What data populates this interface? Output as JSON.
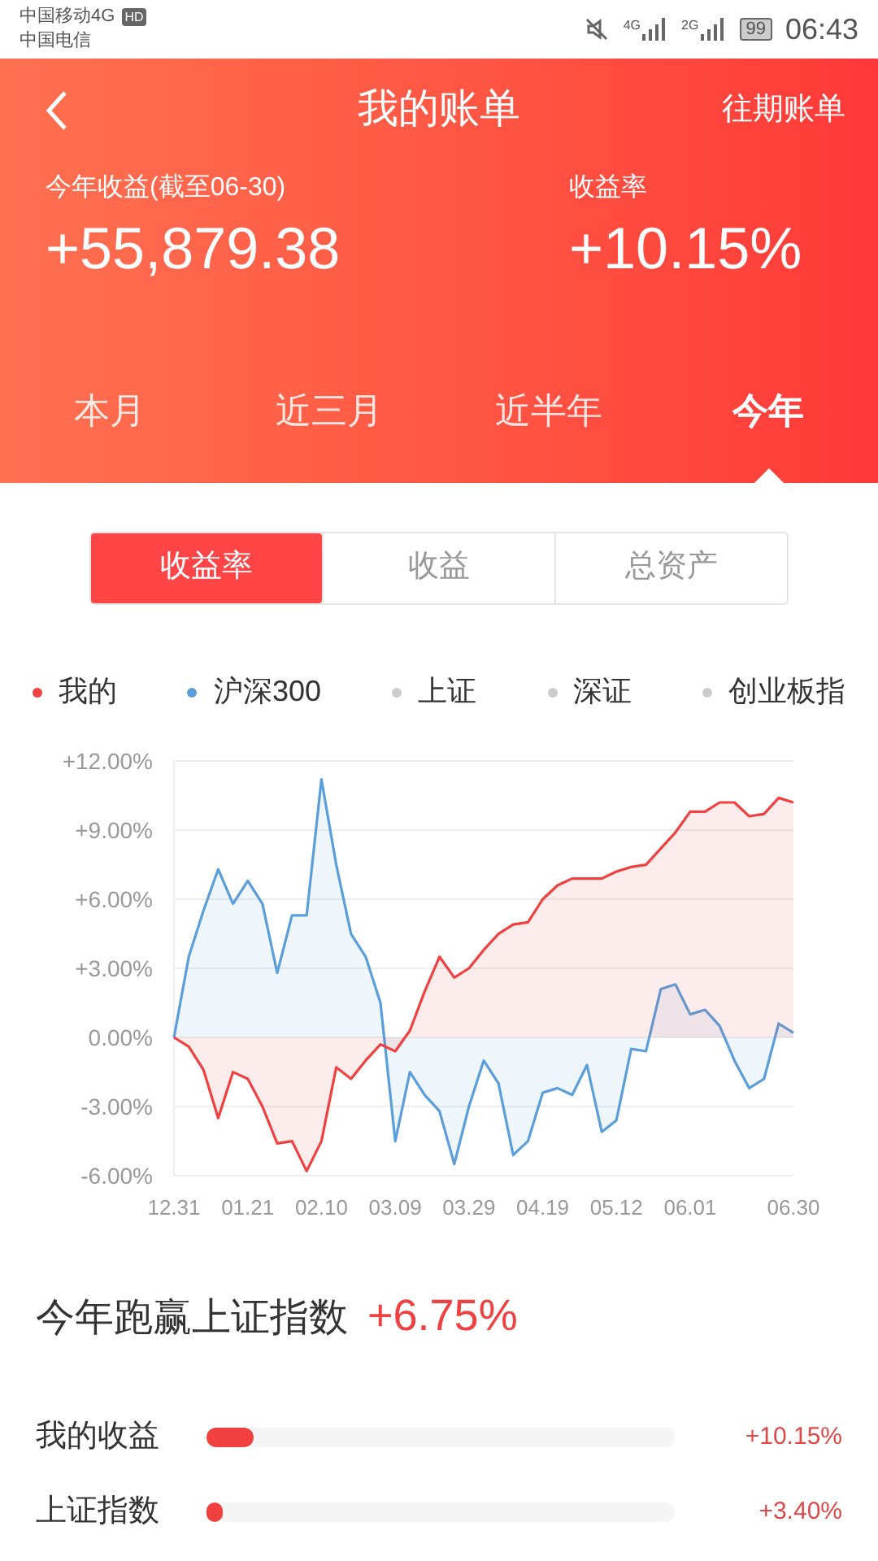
{
  "status_bar": {
    "carrier_1": "中国移动4G",
    "carrier_1_badge": "HD",
    "carrier_2": "中国电信",
    "signal_1_label": "4G",
    "signal_2_label": "2G",
    "battery": "99",
    "time": "06:43"
  },
  "header": {
    "title": "我的账单",
    "link": "往期账单",
    "income_label": "今年收益(截至06-30)",
    "income_value": "+55,879.38",
    "rate_label": "收益率",
    "rate_value": "+10.15%"
  },
  "period_tabs": [
    {
      "label": "本月",
      "selected": false
    },
    {
      "label": "近三月",
      "selected": false
    },
    {
      "label": "近半年",
      "selected": false
    },
    {
      "label": "今年",
      "selected": true
    }
  ],
  "segments": [
    {
      "label": "收益率",
      "selected": true
    },
    {
      "label": "收益",
      "selected": false
    },
    {
      "label": "总资产",
      "selected": false
    }
  ],
  "legend": [
    {
      "label": "上证",
      "color": "#cccccc"
    },
    {
      "label": "深证",
      "color": "#cccccc"
    },
    {
      "label": "创业板指",
      "color": "#cccccc"
    }
  ],
  "chart_data": {
    "type": "area",
    "categories": [
      "12.31",
      null,
      null,
      null,
      null,
      "01.21",
      null,
      null,
      null,
      null,
      "02.10",
      null,
      null,
      null,
      null,
      "03.09",
      null,
      null,
      null,
      null,
      "03.29",
      null,
      null,
      null,
      null,
      "04.19",
      null,
      null,
      null,
      null,
      "05.12",
      null,
      null,
      null,
      null,
      "06.01",
      null,
      null,
      null,
      null,
      null,
      null,
      "06.30"
    ],
    "yticks": [
      {
        "value": 12,
        "label": "+12.00%"
      },
      {
        "value": 9,
        "label": "+9.00%"
      },
      {
        "value": 6,
        "label": "+6.00%"
      },
      {
        "value": 3,
        "label": "+3.00%"
      },
      {
        "value": 0,
        "label": "0.00%"
      },
      {
        "value": -3,
        "label": "-3.00%"
      },
      {
        "value": -6,
        "label": "-6.00%"
      }
    ],
    "ylim": [
      -6,
      12
    ],
    "grid": true,
    "series": [
      {
        "name": "我的",
        "color": "#f04040",
        "values": [
          0,
          -0.4,
          -1.4,
          -3.5,
          -1.5,
          -1.8,
          -3,
          -4.6,
          -4.5,
          -5.8,
          -4.5,
          -1.3,
          -1.8,
          -1,
          -0.3,
          -0.6,
          0.3,
          2,
          3.5,
          2.6,
          3,
          3.8,
          4.5,
          4.9,
          5,
          6,
          6.6,
          6.9,
          6.9,
          6.9,
          7.2,
          7.4,
          7.5,
          8.2,
          8.9,
          9.8,
          9.8,
          10.2,
          10.2,
          9.6,
          9.7,
          10.4,
          10.2
        ]
      },
      {
        "name": "沪深300",
        "color": "#5a9fdc",
        "values": [
          0,
          3.5,
          5.5,
          7.3,
          5.8,
          6.8,
          5.8,
          2.8,
          5.3,
          5.3,
          11.2,
          7.5,
          4.5,
          3.5,
          1.5,
          -4.5,
          -1.5,
          -2.5,
          -3.2,
          -5.5,
          -3,
          -1,
          -2,
          -5.1,
          -4.5,
          -2.4,
          -2.2,
          -2.5,
          -1.2,
          -4.1,
          -3.6,
          -0.5,
          -0.6,
          2.1,
          2.3,
          1,
          1.2,
          0.5,
          -1,
          -2.2,
          -1.8,
          0.6,
          0.2
        ]
      }
    ]
  },
  "beat": {
    "label": "今年跑赢上证指数",
    "value": "+6.75%"
  },
  "comparison": [
    {
      "label": "我的收益",
      "level": 0.1,
      "reading": "+10.15%"
    },
    {
      "label": "上证指数",
      "level": 0.03,
      "reading": "+3.40%"
    }
  ]
}
